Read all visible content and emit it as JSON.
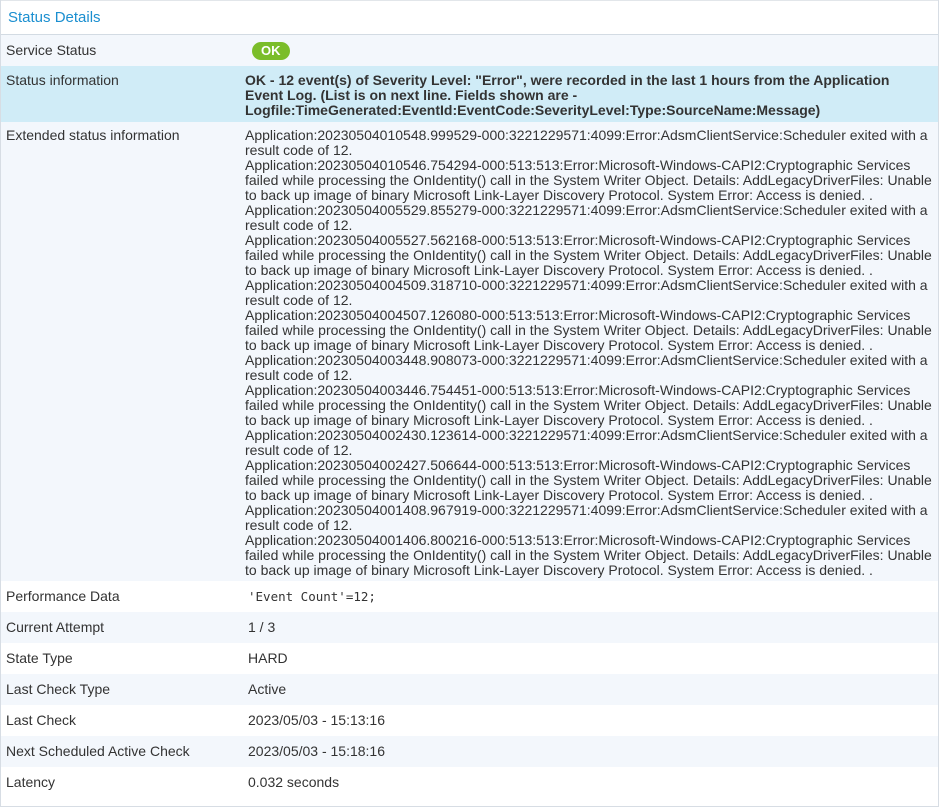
{
  "panel": {
    "title": "Status Details"
  },
  "service_status": {
    "label": "Service Status",
    "value": "OK",
    "color": "#7bbd2a"
  },
  "status_information": {
    "label": "Status information",
    "value": "OK - 12 event(s) of Severity Level: \"Error\", were recorded in the last 1 hours from the Application Event Log. (List is on next line. Fields shown are - Logfile:TimeGenerated:EventId:EventCode:SeverityLevel:Type:SourceName:Message)"
  },
  "extended_status": {
    "label": "Extended status information",
    "lines": [
      "Application:20230504010548.999529-000:3221229571:4099:Error:AdsmClientService:Scheduler exited with a result code of 12.",
      "Application:20230504010546.754294-000:513:513:Error:Microsoft-Windows-CAPI2:Cryptographic Services failed while processing the OnIdentity() call in the System Writer Object. Details: AddLegacyDriverFiles: Unable to back up image of binary Microsoft Link-Layer Discovery Protocol. System Error: Access is denied. .",
      "Application:20230504005529.855279-000:3221229571:4099:Error:AdsmClientService:Scheduler exited with a result code of 12.",
      "Application:20230504005527.562168-000:513:513:Error:Microsoft-Windows-CAPI2:Cryptographic Services failed while processing the OnIdentity() call in the System Writer Object. Details: AddLegacyDriverFiles: Unable to back up image of binary Microsoft Link-Layer Discovery Protocol. System Error: Access is denied. .",
      "Application:20230504004509.318710-000:3221229571:4099:Error:AdsmClientService:Scheduler exited with a result code of 12.",
      "Application:20230504004507.126080-000:513:513:Error:Microsoft-Windows-CAPI2:Cryptographic Services failed while processing the OnIdentity() call in the System Writer Object. Details: AddLegacyDriverFiles: Unable to back up image of binary Microsoft Link-Layer Discovery Protocol. System Error: Access is denied. .",
      "Application:20230504003448.908073-000:3221229571:4099:Error:AdsmClientService:Scheduler exited with a result code of 12.",
      "Application:20230504003446.754451-000:513:513:Error:Microsoft-Windows-CAPI2:Cryptographic Services failed while processing the OnIdentity() call in the System Writer Object. Details: AddLegacyDriverFiles: Unable to back up image of binary Microsoft Link-Layer Discovery Protocol. System Error: Access is denied. .",
      "Application:20230504002430.123614-000:3221229571:4099:Error:AdsmClientService:Scheduler exited with a result code of 12.",
      "Application:20230504002427.506644-000:513:513:Error:Microsoft-Windows-CAPI2:Cryptographic Services failed while processing the OnIdentity() call in the System Writer Object. Details: AddLegacyDriverFiles: Unable to back up image of binary Microsoft Link-Layer Discovery Protocol. System Error: Access is denied. .",
      "Application:20230504001408.967919-000:3221229571:4099:Error:AdsmClientService:Scheduler exited with a result code of 12.",
      "Application:20230504001406.800216-000:513:513:Error:Microsoft-Windows-CAPI2:Cryptographic Services failed while processing the OnIdentity() call in the System Writer Object. Details: AddLegacyDriverFiles: Unable to back up image of binary Microsoft Link-Layer Discovery Protocol. System Error: Access is denied. ."
    ]
  },
  "performance_data": {
    "label": "Performance Data",
    "value": "'Event Count'=12;"
  },
  "current_attempt": {
    "label": "Current Attempt",
    "value": "1 / 3"
  },
  "state_type": {
    "label": "State Type",
    "value": "HARD"
  },
  "last_check_type": {
    "label": "Last Check Type",
    "value": "Active"
  },
  "last_check": {
    "label": "Last Check",
    "value": "2023/05/03 - 15:13:16"
  },
  "next_check": {
    "label": "Next Scheduled Active Check",
    "value": "2023/05/03 - 15:18:16"
  },
  "latency": {
    "label": "Latency",
    "value": "0.032 seconds"
  }
}
